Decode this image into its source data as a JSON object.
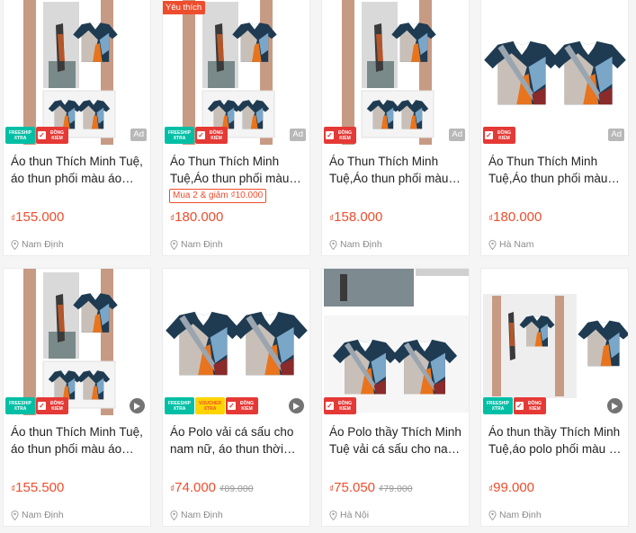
{
  "cards": [
    {
      "title": "Áo thun Thích Minh Tuệ, áo thun phối màu áo thầy Thích Minh Tuệ",
      "currency": "₫",
      "price": "155.000",
      "location": "Nam Định",
      "badges": {
        "ship": "FREESHIP XTRA",
        "dk": "ĐỒNG KIỂM"
      },
      "ad": "Ad"
    },
    {
      "title": "Áo Thun Thích Minh Tuệ,Áo thun phối màu áo thầy",
      "currency": "₫",
      "price": "180.000",
      "location": "Nam Định",
      "badges": {
        "ship": "FREESHIP XTRA",
        "dk": "ĐỒNG KIỂM"
      },
      "ad": "Ad",
      "favorite": "Yêu thích",
      "promo": "Mua 2 & giảm ₫10.000"
    },
    {
      "title": "Áo Thun Thích Minh Tuệ,Áo thun phối màu áo thầy",
      "currency": "₫",
      "price": "158.000",
      "location": "Nam Định",
      "badges": {
        "dk": "ĐỒNG KIỂM"
      },
      "ad": "Ad"
    },
    {
      "title": "Áo Thun Thích Minh Tuệ,Áo thun phối màu áo thầy",
      "currency": "₫",
      "price": "180.000",
      "location": "Hà Nam",
      "badges": {
        "dk": "ĐỒNG KIỂM"
      },
      "ad": "Ad"
    },
    {
      "title": "Áo thun Thích Minh Tuệ, áo thun phối màu áo thầy Thích Minh Tuệ",
      "currency": "₫",
      "price": "155.500",
      "location": "Nam Định",
      "badges": {
        "ship": "FREESHIP XTRA",
        "dk": "ĐỒNG KIỂM"
      }
    },
    {
      "title": "Áo Polo vải cá sấu cho nam nữ, áo thun thời trang",
      "currency": "₫",
      "price": "74.000",
      "old_price": "₫89.000",
      "location": "Nam Định",
      "badges": {
        "ship": "FREESHIP XTRA",
        "voucher": "VOUCHER XTRA",
        "dk": "ĐỒNG KIỂM"
      }
    },
    {
      "title": "Áo Polo thầy Thích Minh Tuệ vải cá sấu cho nam nữ",
      "currency": "₫",
      "price": "75.050",
      "old_price": "₫79.000",
      "location": "Hà Nội",
      "badges": {
        "dk": "ĐỒNG KIỂM"
      }
    },
    {
      "title": "Áo thun thầy Thích Minh Tuệ,áo polo phối màu áo thầy",
      "currency": "₫",
      "price": "99.000",
      "location": "Nam Định",
      "badges": {
        "ship": "FREESHIP XTRA",
        "dk": "ĐỒNG KIỂM"
      }
    }
  ],
  "colors": {
    "accent": "#ee4d2d",
    "freeship": "#00bfa5",
    "voucher": "#ffd400",
    "dongkiem": "#e53935"
  },
  "icons": {
    "location": "location-pin-icon",
    "video": "play-icon",
    "check": "check-icon"
  }
}
